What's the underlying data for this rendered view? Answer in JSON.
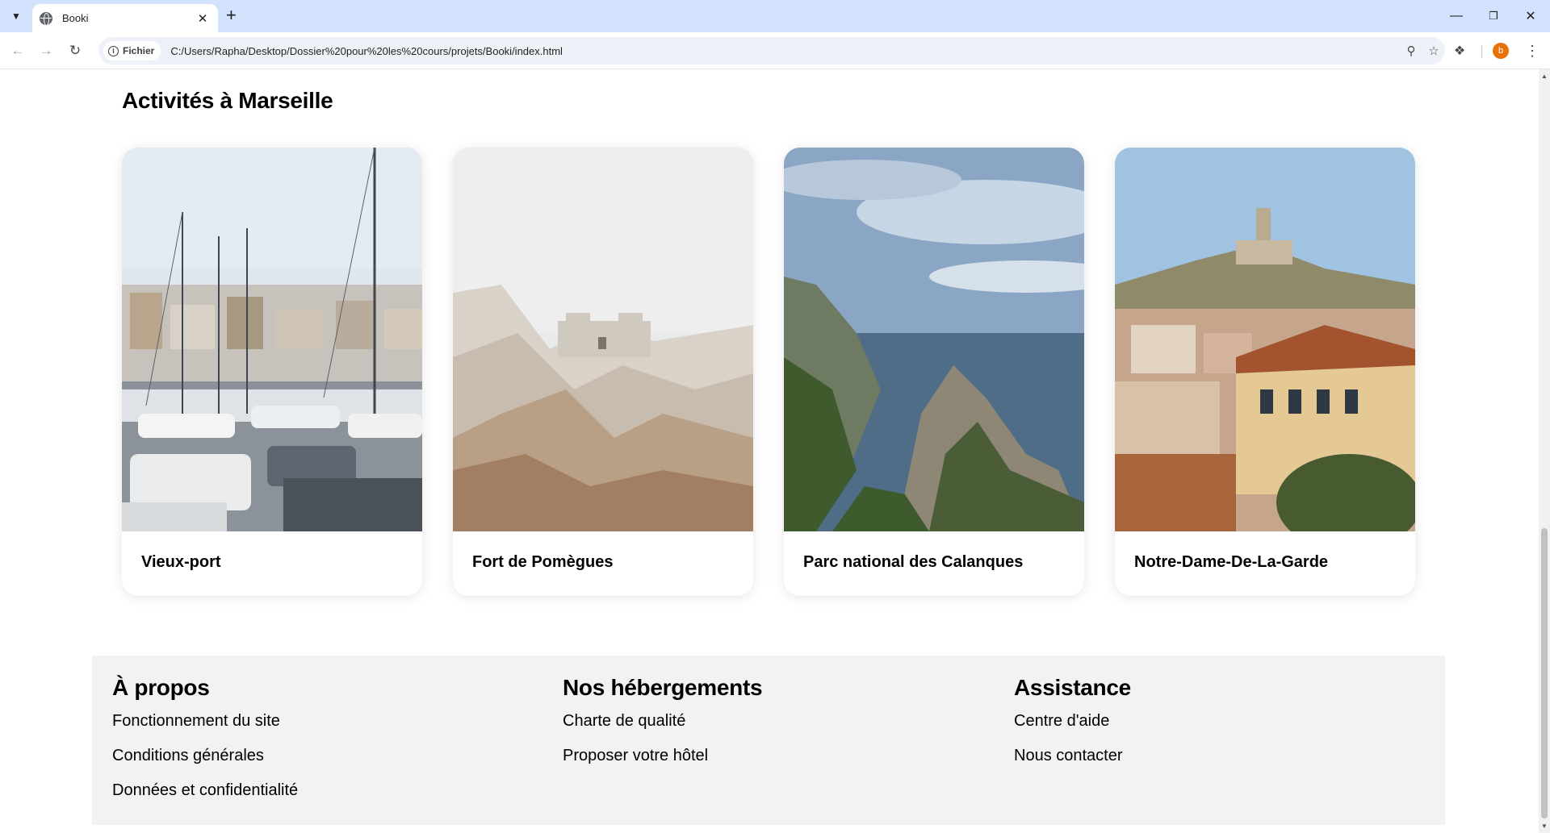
{
  "browser": {
    "tab_title": "Booki",
    "new_tab": "+",
    "site_chip_label": "Fichier",
    "url": "C:/Users/Rapha/Desktop/Dossier%20pour%20les%20cours/projets/Booki/index.html",
    "profile_initial": "b",
    "icons": [
      "tab-list-icon",
      "globe-icon",
      "close-icon",
      "back-icon",
      "forward-icon",
      "reload-icon",
      "info-icon",
      "zoom-icon",
      "star-icon",
      "extensions-icon",
      "menu-icon",
      "minimize-icon",
      "restore-icon",
      "window-close-icon"
    ]
  },
  "page": {
    "section_title": "Activités à Marseille",
    "cards": [
      {
        "title": "Vieux-port"
      },
      {
        "title": "Fort de Pomègues"
      },
      {
        "title": "Parc national des Calanques"
      },
      {
        "title": "Notre-Dame-De-La-Garde"
      }
    ],
    "footer": [
      {
        "heading": "À propos",
        "links": [
          "Fonctionnement du site",
          "Conditions générales",
          "Données et confidentialité"
        ]
      },
      {
        "heading": "Nos hébergements",
        "links": [
          "Charte de qualité",
          "Proposer votre hôtel"
        ]
      },
      {
        "heading": "Assistance",
        "links": [
          "Centre d'aide",
          "Nous contacter"
        ]
      }
    ]
  },
  "colors": {
    "tabbar": "#d3e3fd",
    "footer_bg": "#f2f2f2",
    "avatar": "#e8710a"
  }
}
